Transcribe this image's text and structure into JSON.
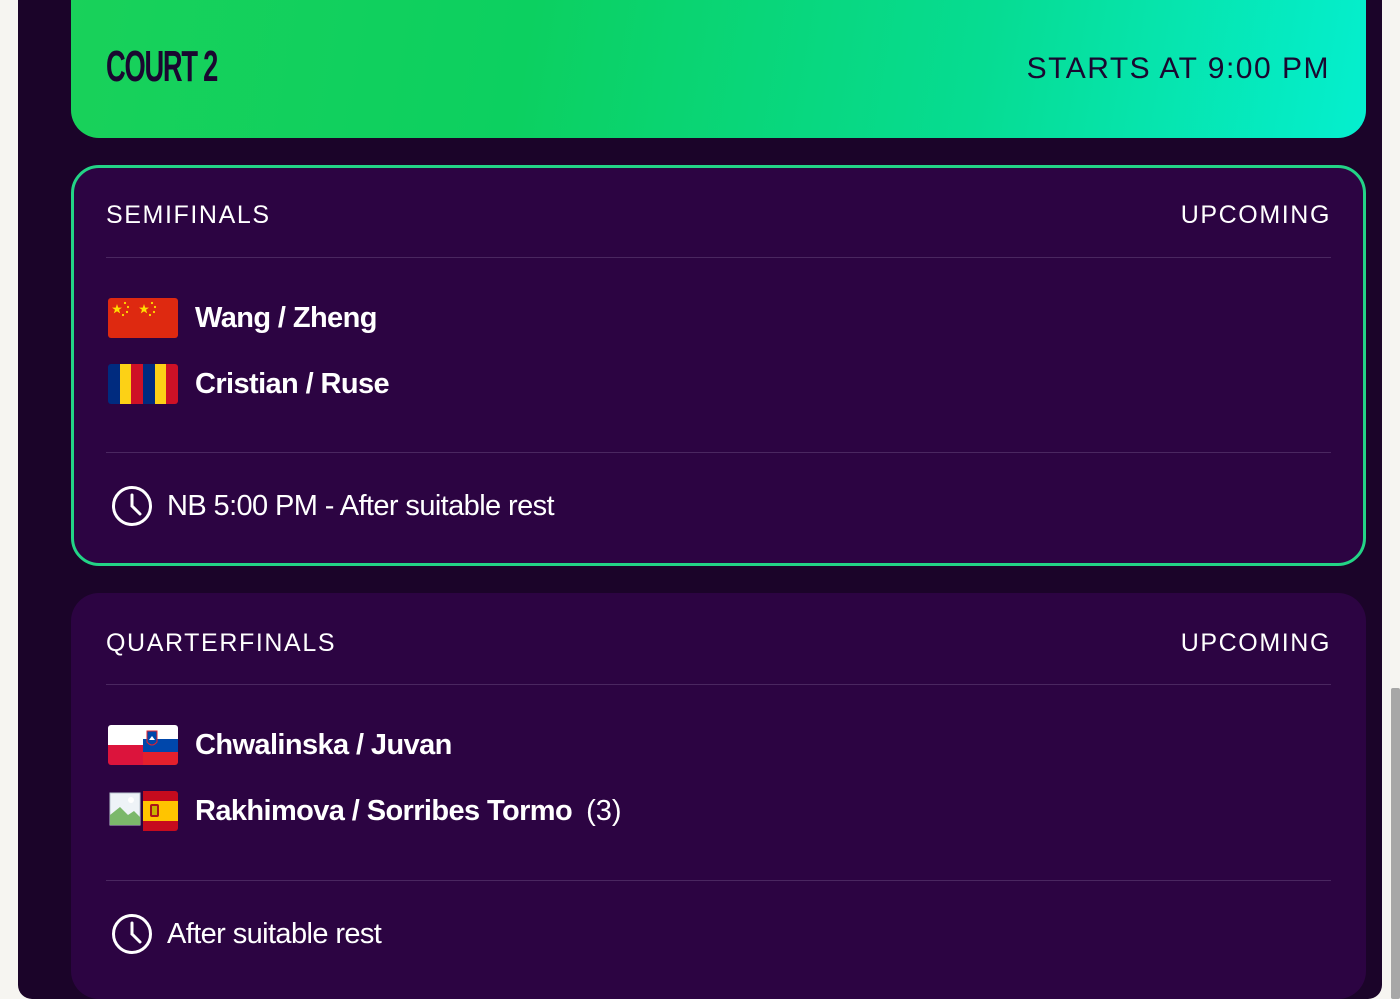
{
  "court": {
    "title": "COURT 2",
    "start_time": "STARTS AT 9:00 PM"
  },
  "matches": [
    {
      "round": "SEMIFINALS",
      "status": "UPCOMING",
      "teams": [
        {
          "name": "Wang / Zheng",
          "flags": [
            "china-flag-icon"
          ],
          "seed": ""
        },
        {
          "name": "Cristian / Ruse",
          "flags": [
            "romania-flag-icon"
          ],
          "seed": ""
        }
      ],
      "time": "NB 5:00 PM - After suitable rest"
    },
    {
      "round": "QUARTERFINALS",
      "status": "UPCOMING",
      "teams": [
        {
          "name": "Chwalinska / Juvan",
          "flags": [
            "poland-flag-icon",
            "slovenia-flag-icon"
          ],
          "seed": ""
        },
        {
          "name": "Rakhimova / Sorribes Tormo",
          "flags": [
            "broken-image-icon",
            "spain-flag-icon"
          ],
          "seed": "(3)"
        }
      ],
      "time": "After suitable rest"
    }
  ],
  "colors": {
    "page_background": "#1b0429",
    "card_background": "#2c0442",
    "active_border": "#23d486",
    "header_gradient_start": "#19d15a",
    "header_gradient_end": "#05efcf",
    "header_text": "#1a0730",
    "text": "#ffffff"
  }
}
